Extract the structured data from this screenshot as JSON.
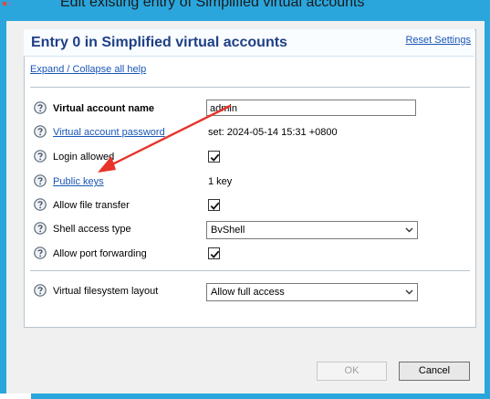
{
  "window": {
    "title": "Edit existing entry of Simplified virtual accounts"
  },
  "panel": {
    "title": "Entry 0 in Simplified virtual accounts",
    "reset_label": "Reset Settings",
    "expand_label": "Expand / Collapse all help"
  },
  "fields": {
    "account_name": {
      "label": "Virtual account name",
      "value": "admin"
    },
    "password": {
      "label": "Virtual account password",
      "value": "set:  2024-05-14 15:31 +0800"
    },
    "login_allowed": {
      "label": "Login allowed",
      "checked": true
    },
    "public_keys": {
      "label": "Public keys",
      "value": "1 key"
    },
    "file_transfer": {
      "label": "Allow file transfer",
      "checked": true
    },
    "shell_access": {
      "label": "Shell access type",
      "value": "BvShell"
    },
    "port_forwarding": {
      "label": "Allow port forwarding",
      "checked": true
    },
    "fs_layout": {
      "label": "Virtual filesystem layout",
      "value": "Allow full access"
    }
  },
  "buttons": {
    "ok": "OK",
    "cancel": "Cancel"
  },
  "colors": {
    "frame": "#2aa6dc",
    "title_text": "#1e3f86",
    "link": "#1a56b6",
    "help_icon": "#5a6a78",
    "annotation_arrow": "#e8332a"
  },
  "icons": {
    "help": "question-mark-circle-icon",
    "checkmark": "checkmark-icon",
    "dropdown": "chevron-down-icon"
  }
}
